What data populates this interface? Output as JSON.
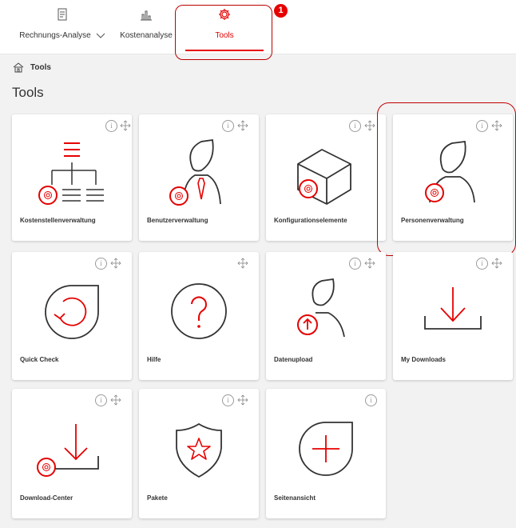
{
  "nav": {
    "tabs": [
      {
        "label": "Rechnungs-Analyse",
        "icon": "document-icon",
        "dropdown": true
      },
      {
        "label": "Kostenanalyse",
        "icon": "bar-chart-icon"
      },
      {
        "label": "Tools",
        "icon": "gear-icon",
        "active": true
      }
    ],
    "badge": "1"
  },
  "breadcrumb": {
    "home_label": "Tools"
  },
  "page": {
    "title": "Tools"
  },
  "tiles": [
    {
      "label": "Kostenstellenverwaltung"
    },
    {
      "label": "Benutzerverwaltung"
    },
    {
      "label": "Konfigurationselemente"
    },
    {
      "label": "Personenverwaltung"
    },
    {
      "label": "Quick Check"
    },
    {
      "label": "Hilfe"
    },
    {
      "label": "Datenupload"
    },
    {
      "label": "My Downloads"
    },
    {
      "label": "Download-Center"
    },
    {
      "label": "Pakete"
    },
    {
      "label": "Seitenansicht"
    }
  ],
  "info_glyph": "i",
  "colors": {
    "accent": "#e60000",
    "icon_dark": "#333333",
    "background": "#f2f2f2",
    "highlight": "#c00000"
  }
}
